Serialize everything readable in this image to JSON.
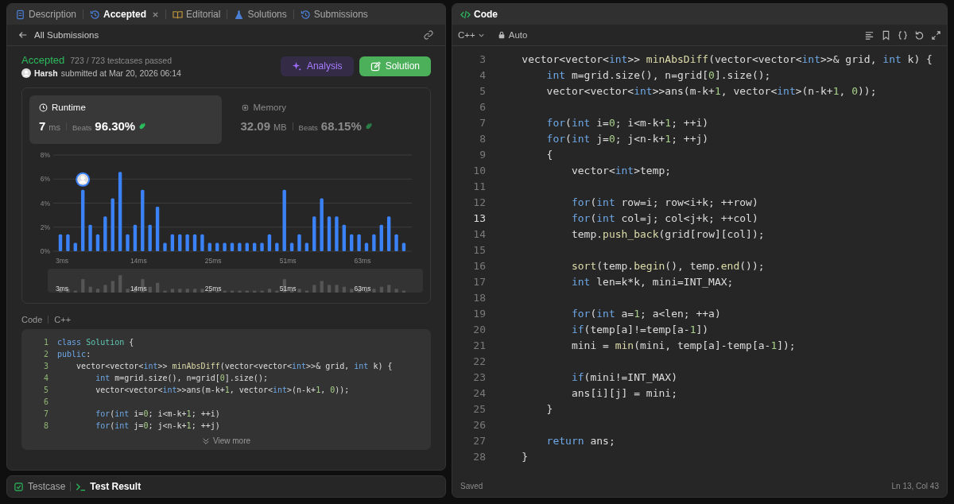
{
  "tabs": [
    {
      "label": "Description",
      "kind": "doc",
      "selected": false,
      "closable": false
    },
    {
      "label": "Accepted",
      "kind": "history",
      "selected": true,
      "closable": true
    },
    {
      "label": "Editorial",
      "kind": "book",
      "selected": false,
      "closable": false
    },
    {
      "label": "Solutions",
      "kind": "flask",
      "selected": false,
      "closable": false
    },
    {
      "label": "Submissions",
      "kind": "history",
      "selected": false,
      "closable": false
    }
  ],
  "back_link": "All Submissions",
  "submission": {
    "status": "Accepted",
    "tests": "723 / 723 testcases passed",
    "user": "Harsh",
    "submitted": "submitted at Mar 20, 2026 06:14"
  },
  "actions": [
    {
      "label": "Analysis",
      "kind": "analysis"
    },
    {
      "label": "Solution",
      "kind": "solution"
    }
  ],
  "stats": [
    {
      "label": "Runtime",
      "kind": "clock",
      "value": "7",
      "unit": "ms",
      "beats_label": "Beats",
      "beats": "96.30%",
      "selected": true
    },
    {
      "label": "Memory",
      "kind": "chip",
      "value": "32.09",
      "unit": "MB",
      "beats_label": "Beats",
      "beats": "68.15%",
      "selected": false
    }
  ],
  "chart_data": {
    "type": "bar",
    "categories": [
      "3ms",
      null,
      null,
      null,
      null,
      null,
      null,
      null,
      null,
      null,
      "14ms",
      null,
      null,
      null,
      null,
      null,
      null,
      null,
      null,
      null,
      "25ms",
      null,
      null,
      null,
      null,
      null,
      null,
      null,
      null,
      null,
      "51ms",
      null,
      null,
      null,
      null,
      null,
      null,
      null,
      null,
      null,
      "63ms",
      null,
      null,
      null,
      null,
      null,
      null
    ],
    "values": [
      1.4,
      1.4,
      0.7,
      5.1,
      2.2,
      1.4,
      2.9,
      4.4,
      6.6,
      1.4,
      2.2,
      5.1,
      2.2,
      3.7,
      0.7,
      1.4,
      1.4,
      1.4,
      1.4,
      1.4,
      0.7,
      0.7,
      0.7,
      0.7,
      0.7,
      0.7,
      0.7,
      0.7,
      1.4,
      0.7,
      5.1,
      0.7,
      1.4,
      0.7,
      2.9,
      4.4,
      2.9,
      2.9,
      2.2,
      1.4,
      1.4,
      0.7,
      1.4,
      2.2,
      2.9,
      1.4,
      0.7
    ],
    "ylim": [
      0,
      8
    ],
    "yticks": [
      {
        "value": 0,
        "label": "0%"
      },
      {
        "value": 2,
        "label": "2%"
      },
      {
        "value": 4,
        "label": "4%"
      },
      {
        "value": 6,
        "label": "6%"
      },
      {
        "value": 8,
        "label": "8%"
      }
    ],
    "grid": true
  },
  "bars": [
    {
      "selected": false
    },
    {
      "selected": false
    },
    {
      "selected": false
    },
    {
      "selected": true
    },
    {
      "selected": false
    },
    {
      "selected": false
    },
    {
      "selected": false
    },
    {
      "selected": false
    },
    {
      "selected": false
    },
    {
      "selected": false
    },
    {
      "selected": false
    },
    {
      "selected": false
    },
    {
      "selected": false
    },
    {
      "selected": false
    },
    {
      "selected": false
    },
    {
      "selected": false
    },
    {
      "selected": false
    },
    {
      "selected": false
    },
    {
      "selected": false
    },
    {
      "selected": false
    },
    {
      "selected": false
    },
    {
      "selected": false
    },
    {
      "selected": false
    },
    {
      "selected": false
    },
    {
      "selected": false
    },
    {
      "selected": false
    },
    {
      "selected": false
    },
    {
      "selected": false
    },
    {
      "selected": false
    },
    {
      "selected": false
    },
    {
      "selected": false
    },
    {
      "selected": false
    },
    {
      "selected": false
    },
    {
      "selected": false
    },
    {
      "selected": false
    },
    {
      "selected": false
    },
    {
      "selected": false
    },
    {
      "selected": false
    },
    {
      "selected": false
    },
    {
      "selected": false
    },
    {
      "selected": false
    },
    {
      "selected": false
    },
    {
      "selected": false
    },
    {
      "selected": false
    },
    {
      "selected": false
    },
    {
      "selected": false
    },
    {
      "selected": false
    }
  ],
  "overview_labels": [
    "3ms",
    "14ms",
    "25ms",
    "51ms",
    "63ms"
  ],
  "code_section": {
    "title": "Code",
    "language": "C++",
    "more": "View more",
    "lines": [
      {
        "n": "1",
        "tokens": [
          {
            "text": "class",
            "kind": "keyword"
          },
          {
            "text": " Solution",
            "kind": "class"
          },
          {
            "text": " {",
            "kind": "plain"
          }
        ]
      },
      {
        "n": "2",
        "tokens": [
          {
            "text": "public",
            "kind": "keyword"
          },
          {
            "text": ":",
            "kind": "plain"
          }
        ]
      },
      {
        "n": "3",
        "tokens": [
          {
            "text": "    vector<vector<",
            "kind": "plain"
          },
          {
            "text": "int",
            "kind": "keyword"
          },
          {
            "text": ">> ",
            "kind": "plain"
          },
          {
            "text": "minAbsDiff",
            "kind": "function"
          },
          {
            "text": "(vector<vector<",
            "kind": "plain"
          },
          {
            "text": "int",
            "kind": "keyword"
          },
          {
            "text": ">>& grid, ",
            "kind": "plain"
          },
          {
            "text": "int",
            "kind": "keyword"
          },
          {
            "text": " k) {",
            "kind": "plain"
          }
        ]
      },
      {
        "n": "4",
        "tokens": [
          {
            "text": "        int",
            "kind": "keyword"
          },
          {
            "text": " m=grid.size(), n=grid[",
            "kind": "plain"
          },
          {
            "text": "0",
            "kind": "number"
          },
          {
            "text": "].size();",
            "kind": "plain"
          }
        ]
      },
      {
        "n": "5",
        "tokens": [
          {
            "text": "        vector<vector<",
            "kind": "plain"
          },
          {
            "text": "int",
            "kind": "keyword"
          },
          {
            "text": ">>ans(m-k+",
            "kind": "plain"
          },
          {
            "text": "1",
            "kind": "number"
          },
          {
            "text": ", vector<",
            "kind": "plain"
          },
          {
            "text": "int",
            "kind": "keyword"
          },
          {
            "text": ">(n-k+",
            "kind": "plain"
          },
          {
            "text": "1",
            "kind": "number"
          },
          {
            "text": ", ",
            "kind": "plain"
          },
          {
            "text": "0",
            "kind": "number"
          },
          {
            "text": "));",
            "kind": "plain"
          }
        ]
      },
      {
        "n": "6"
      },
      {
        "n": "7",
        "tokens": [
          {
            "text": "        for",
            "kind": "keyword"
          },
          {
            "text": "(",
            "kind": "plain"
          },
          {
            "text": "int",
            "kind": "keyword"
          },
          {
            "text": " i=",
            "kind": "plain"
          },
          {
            "text": "0",
            "kind": "number"
          },
          {
            "text": "; i<m-k+",
            "kind": "plain"
          },
          {
            "text": "1",
            "kind": "number"
          },
          {
            "text": "; ++i)",
            "kind": "plain"
          }
        ]
      },
      {
        "n": "8",
        "tokens": [
          {
            "text": "        for",
            "kind": "keyword"
          },
          {
            "text": "(",
            "kind": "plain"
          },
          {
            "text": "int",
            "kind": "keyword"
          },
          {
            "text": " j=",
            "kind": "plain"
          },
          {
            "text": "0",
            "kind": "number"
          },
          {
            "text": "; j<n-k+",
            "kind": "plain"
          },
          {
            "text": "1",
            "kind": "number"
          },
          {
            "text": "; ++j)",
            "kind": "plain"
          }
        ]
      }
    ]
  },
  "bottom_tabs": [
    {
      "label": "Testcase",
      "kind": "check",
      "selected": false
    },
    {
      "label": "Test Result",
      "kind": "terminal",
      "selected": true
    }
  ],
  "editor": {
    "title": "Code",
    "language": "C++",
    "mode": "Auto",
    "status": "Saved",
    "cursor": "Ln 13, Col 43",
    "lines": [
      {
        "n": "3",
        "active": false,
        "tokens": [
          {
            "text": "    vector<vector<",
            "kind": "plain"
          },
          {
            "text": "int",
            "kind": "keyword"
          },
          {
            "text": ">> ",
            "kind": "plain"
          },
          {
            "text": "minAbsDiff",
            "kind": "function"
          },
          {
            "text": "(vector<vector<",
            "kind": "plain"
          },
          {
            "text": "int",
            "kind": "keyword"
          },
          {
            "text": ">>& grid, ",
            "kind": "plain"
          },
          {
            "text": "int",
            "kind": "keyword"
          },
          {
            "text": " k) {",
            "kind": "plain"
          }
        ]
      },
      {
        "n": "4",
        "active": false,
        "tokens": [
          {
            "text": "        int",
            "kind": "keyword"
          },
          {
            "text": " m=grid.size(), n=grid[",
            "kind": "plain"
          },
          {
            "text": "0",
            "kind": "number"
          },
          {
            "text": "].size();",
            "kind": "plain"
          }
        ]
      },
      {
        "n": "5",
        "active": false,
        "tokens": [
          {
            "text": "        vector<vector<",
            "kind": "plain"
          },
          {
            "text": "int",
            "kind": "keyword"
          },
          {
            "text": ">>ans(m-k+",
            "kind": "plain"
          },
          {
            "text": "1",
            "kind": "number"
          },
          {
            "text": ", vector<",
            "kind": "plain"
          },
          {
            "text": "int",
            "kind": "keyword"
          },
          {
            "text": ">(n-k+",
            "kind": "plain"
          },
          {
            "text": "1",
            "kind": "number"
          },
          {
            "text": ", ",
            "kind": "plain"
          },
          {
            "text": "0",
            "kind": "number"
          },
          {
            "text": "));",
            "kind": "plain"
          }
        ]
      },
      {
        "n": "6",
        "active": false
      },
      {
        "n": "7",
        "active": false,
        "tokens": [
          {
            "text": "        for",
            "kind": "keyword"
          },
          {
            "text": "(",
            "kind": "plain"
          },
          {
            "text": "int",
            "kind": "keyword"
          },
          {
            "text": " i=",
            "kind": "plain"
          },
          {
            "text": "0",
            "kind": "number"
          },
          {
            "text": "; i<m-k+",
            "kind": "plain"
          },
          {
            "text": "1",
            "kind": "number"
          },
          {
            "text": "; ++i)",
            "kind": "plain"
          }
        ]
      },
      {
        "n": "8",
        "active": false,
        "tokens": [
          {
            "text": "        for",
            "kind": "keyword"
          },
          {
            "text": "(",
            "kind": "plain"
          },
          {
            "text": "int",
            "kind": "keyword"
          },
          {
            "text": " j=",
            "kind": "plain"
          },
          {
            "text": "0",
            "kind": "number"
          },
          {
            "text": "; j<n-k+",
            "kind": "plain"
          },
          {
            "text": "1",
            "kind": "number"
          },
          {
            "text": "; ++j)",
            "kind": "plain"
          }
        ]
      },
      {
        "n": "9",
        "active": false,
        "tokens": [
          {
            "text": "        {",
            "kind": "plain"
          }
        ]
      },
      {
        "n": "10",
        "active": false,
        "tokens": [
          {
            "text": "            vector<",
            "kind": "plain"
          },
          {
            "text": "int",
            "kind": "keyword"
          },
          {
            "text": ">temp;",
            "kind": "plain"
          }
        ]
      },
      {
        "n": "11",
        "active": false
      },
      {
        "n": "12",
        "active": false,
        "tokens": [
          {
            "text": "            for",
            "kind": "keyword"
          },
          {
            "text": "(",
            "kind": "plain"
          },
          {
            "text": "int",
            "kind": "keyword"
          },
          {
            "text": " row=i; row<i+k; ++row)",
            "kind": "plain"
          }
        ]
      },
      {
        "n": "13",
        "active": true,
        "tokens": [
          {
            "text": "            for",
            "kind": "keyword"
          },
          {
            "text": "(",
            "kind": "plain"
          },
          {
            "text": "int",
            "kind": "keyword"
          },
          {
            "text": " col=j; col<j+k; ++col)",
            "kind": "plain"
          }
        ]
      },
      {
        "n": "14",
        "active": false,
        "tokens": [
          {
            "text": "            temp.",
            "kind": "plain"
          },
          {
            "text": "push_back",
            "kind": "function"
          },
          {
            "text": "(grid[row][col]);",
            "kind": "plain"
          }
        ]
      },
      {
        "n": "15",
        "active": false
      },
      {
        "n": "16",
        "active": false,
        "tokens": [
          {
            "text": "            sort",
            "kind": "function"
          },
          {
            "text": "(temp.",
            "kind": "plain"
          },
          {
            "text": "begin",
            "kind": "function"
          },
          {
            "text": "(), temp.",
            "kind": "plain"
          },
          {
            "text": "end",
            "kind": "function"
          },
          {
            "text": "());",
            "kind": "plain"
          }
        ]
      },
      {
        "n": "17",
        "active": false,
        "tokens": [
          {
            "text": "            int",
            "kind": "keyword"
          },
          {
            "text": " len=k*k, mini=INT_MAX;",
            "kind": "plain"
          }
        ]
      },
      {
        "n": "18",
        "active": false
      },
      {
        "n": "19",
        "active": false,
        "tokens": [
          {
            "text": "            for",
            "kind": "keyword"
          },
          {
            "text": "(",
            "kind": "plain"
          },
          {
            "text": "int",
            "kind": "keyword"
          },
          {
            "text": " a=",
            "kind": "plain"
          },
          {
            "text": "1",
            "kind": "number"
          },
          {
            "text": "; a<len; ++a)",
            "kind": "plain"
          }
        ]
      },
      {
        "n": "20",
        "active": false,
        "tokens": [
          {
            "text": "            if",
            "kind": "keyword"
          },
          {
            "text": "(temp[a]!=temp[a-",
            "kind": "plain"
          },
          {
            "text": "1",
            "kind": "number"
          },
          {
            "text": "])",
            "kind": "plain"
          }
        ]
      },
      {
        "n": "21",
        "active": false,
        "tokens": [
          {
            "text": "            mini = ",
            "kind": "plain"
          },
          {
            "text": "min",
            "kind": "function"
          },
          {
            "text": "(mini, temp[a]-temp[a-",
            "kind": "plain"
          },
          {
            "text": "1",
            "kind": "number"
          },
          {
            "text": "]);",
            "kind": "plain"
          }
        ]
      },
      {
        "n": "22",
        "active": false
      },
      {
        "n": "23",
        "active": false,
        "tokens": [
          {
            "text": "            if",
            "kind": "keyword"
          },
          {
            "text": "(mini!=INT_MAX)",
            "kind": "plain"
          }
        ]
      },
      {
        "n": "24",
        "active": false,
        "tokens": [
          {
            "text": "            ans[i][j] = mini;",
            "kind": "plain"
          }
        ]
      },
      {
        "n": "25",
        "active": false,
        "tokens": [
          {
            "text": "        }",
            "kind": "plain"
          }
        ]
      },
      {
        "n": "26",
        "active": false
      },
      {
        "n": "27",
        "active": false,
        "tokens": [
          {
            "text": "        return",
            "kind": "keyword"
          },
          {
            "text": " ans;",
            "kind": "plain"
          }
        ]
      },
      {
        "n": "28",
        "active": false,
        "tokens": [
          {
            "text": "    }",
            "kind": "plain"
          }
        ]
      }
    ]
  }
}
